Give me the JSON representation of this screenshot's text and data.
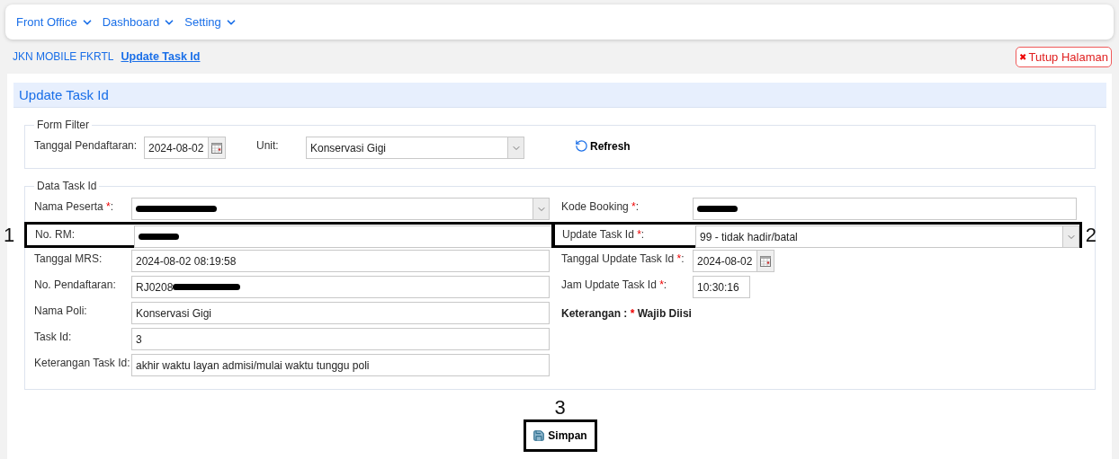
{
  "nav": {
    "items": [
      {
        "label": "Front Office"
      },
      {
        "label": "Dashboard"
      },
      {
        "label": "Setting"
      }
    ]
  },
  "breadcrumb": [
    {
      "label": "JKN MOBILE FKRTL",
      "selected": false
    },
    {
      "label": "Update Task Id",
      "selected": true
    }
  ],
  "close_button": {
    "icon": "✖",
    "label": "Tutup Halaman"
  },
  "panel": {
    "title": "Update Task Id",
    "filter": {
      "legend": "Form Filter",
      "fields": [
        {
          "label": "Tanggal Pendaftaran:",
          "kind": "date",
          "value": "2024-08-02"
        },
        {
          "label": "Unit:",
          "kind": "select",
          "value": "Konservasi Gigi"
        }
      ],
      "refresh": {
        "label": "Refresh"
      }
    },
    "data": {
      "legend": "Data Task Id",
      "left": [
        {
          "label": "Nama Peserta ",
          "required_mark": "*",
          "label_end": ":",
          "kind": "select",
          "redacted": true
        },
        {
          "label": "No. RM:",
          "kind": "text",
          "redacted": true,
          "callout": "1"
        },
        {
          "label": "Tanggal MRS:",
          "kind": "text",
          "value": "2024-08-02 08:19:58"
        },
        {
          "label": "No. Pendaftaran:",
          "kind": "text",
          "value": "RJ0208",
          "redacted": true
        },
        {
          "label": "Nama Poli:",
          "kind": "text",
          "value": "Konservasi Gigi"
        },
        {
          "label": "Task Id:",
          "kind": "text",
          "value": "3"
        },
        {
          "label": "Keterangan Task Id:",
          "kind": "text",
          "value": "akhir waktu layan admisi/mulai waktu tunggu poli"
        }
      ],
      "right": [
        {
          "label": "Kode Booking ",
          "required_mark": "*",
          "label_end": ":",
          "kind": "text",
          "redacted": true
        },
        {
          "label": "Update Task Id ",
          "required_mark": "*",
          "label_end": ":",
          "kind": "select",
          "value": "99 - tidak hadir/batal",
          "callout": "2"
        },
        {
          "label": "Tanggal Update Task Id ",
          "required_mark": "*",
          "label_end": ":",
          "kind": "date",
          "value": "2024-08-02"
        },
        {
          "label": "Jam Update Task Id ",
          "required_mark": "*",
          "label_end": ":",
          "kind": "time",
          "value": "10:30:16"
        }
      ],
      "note": {
        "label": "Keterangan : ",
        "mark": "*",
        "text": " Wajib Diisi"
      }
    },
    "save_button": {
      "label": "Simpan",
      "callout": "3"
    }
  }
}
